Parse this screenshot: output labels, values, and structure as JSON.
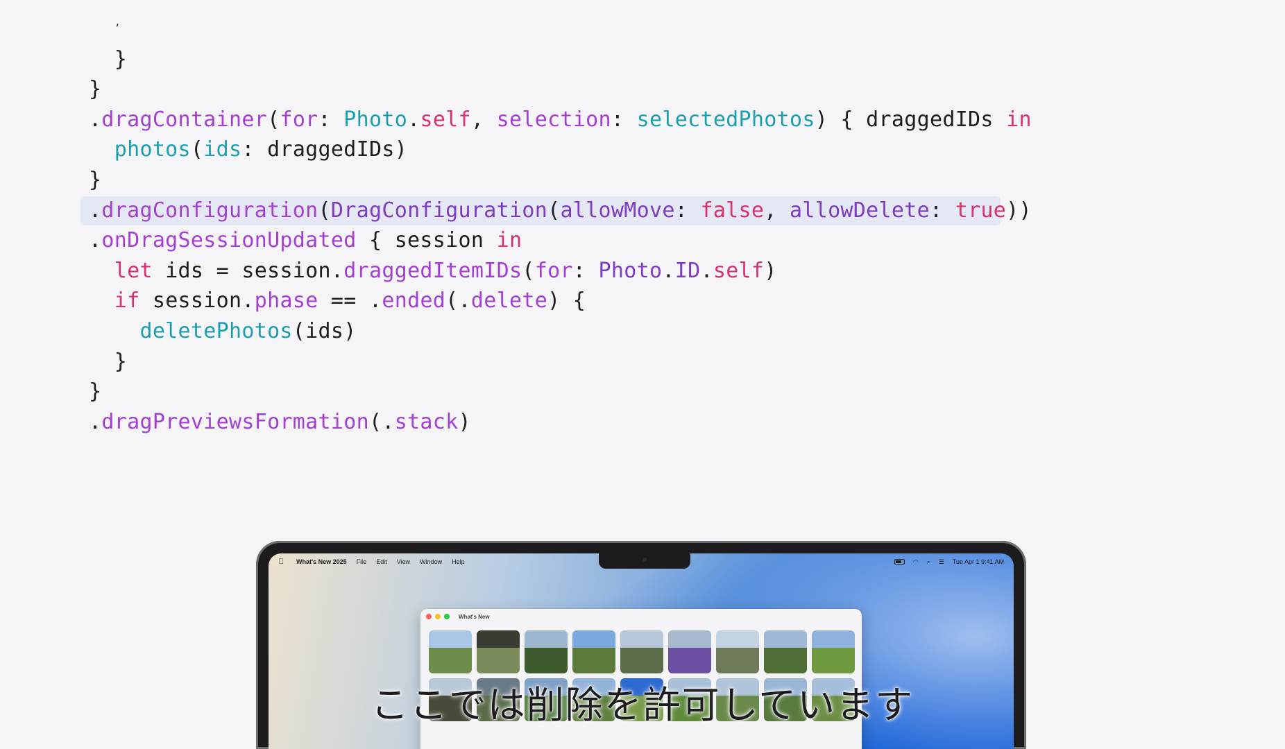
{
  "code": {
    "lines": [
      {
        "indent": 1,
        "tokens": [
          {
            "t": "ʼ",
            "c": "tiny"
          }
        ]
      },
      {
        "indent": 1,
        "tokens": [
          {
            "t": "}",
            "c": "plain"
          }
        ]
      },
      {
        "indent": 0,
        "tokens": [
          {
            "t": "}",
            "c": "plain"
          }
        ]
      },
      {
        "indent": 0,
        "tokens": [
          {
            "t": ".",
            "c": "plain"
          },
          {
            "t": "dragContainer",
            "c": "func"
          },
          {
            "t": "(",
            "c": "plain"
          },
          {
            "t": "for",
            "c": "func"
          },
          {
            "t": ": ",
            "c": "plain"
          },
          {
            "t": "Photo",
            "c": "call"
          },
          {
            "t": ".",
            "c": "plain"
          },
          {
            "t": "self",
            "c": "keyword"
          },
          {
            "t": ", ",
            "c": "plain"
          },
          {
            "t": "selection",
            "c": "func"
          },
          {
            "t": ": ",
            "c": "plain"
          },
          {
            "t": "selectedPhotos",
            "c": "call"
          },
          {
            "t": ") { draggedIDs ",
            "c": "plain"
          },
          {
            "t": "in",
            "c": "keyword"
          }
        ]
      },
      {
        "indent": 1,
        "tokens": [
          {
            "t": "photos",
            "c": "call"
          },
          {
            "t": "(",
            "c": "plain"
          },
          {
            "t": "ids",
            "c": "call"
          },
          {
            "t": ": draggedIDs)",
            "c": "plain"
          }
        ]
      },
      {
        "indent": 0,
        "tokens": [
          {
            "t": "}",
            "c": "plain"
          }
        ]
      },
      {
        "indent": 0,
        "highlight": true,
        "tokens": [
          {
            "t": ".",
            "c": "plain"
          },
          {
            "t": "dragConfiguration",
            "c": "func"
          },
          {
            "t": "(",
            "c": "plain"
          },
          {
            "t": "DragConfiguration",
            "c": "type"
          },
          {
            "t": "(",
            "c": "plain"
          },
          {
            "t": "allowMove",
            "c": "type"
          },
          {
            "t": ": ",
            "c": "plain"
          },
          {
            "t": "false",
            "c": "keyword"
          },
          {
            "t": ", ",
            "c": "plain"
          },
          {
            "t": "allowDelete",
            "c": "type"
          },
          {
            "t": ": ",
            "c": "plain"
          },
          {
            "t": "true",
            "c": "keyword"
          },
          {
            "t": "))",
            "c": "plain"
          }
        ]
      },
      {
        "indent": 0,
        "tokens": [
          {
            "t": ".",
            "c": "plain"
          },
          {
            "t": "onDragSessionUpdated",
            "c": "func"
          },
          {
            "t": " { session ",
            "c": "plain"
          },
          {
            "t": "in",
            "c": "keyword"
          }
        ]
      },
      {
        "indent": 1,
        "tokens": [
          {
            "t": "let",
            "c": "keyword"
          },
          {
            "t": " ids = session.",
            "c": "plain"
          },
          {
            "t": "draggedItemIDs",
            "c": "func"
          },
          {
            "t": "(",
            "c": "plain"
          },
          {
            "t": "for",
            "c": "func"
          },
          {
            "t": ": ",
            "c": "plain"
          },
          {
            "t": "Photo",
            "c": "type"
          },
          {
            "t": ".",
            "c": "plain"
          },
          {
            "t": "ID",
            "c": "type"
          },
          {
            "t": ".",
            "c": "plain"
          },
          {
            "t": "self",
            "c": "keyword"
          },
          {
            "t": ")",
            "c": "plain"
          }
        ]
      },
      {
        "indent": 1,
        "tokens": [
          {
            "t": "if",
            "c": "keyword"
          },
          {
            "t": " session.",
            "c": "plain"
          },
          {
            "t": "phase",
            "c": "func"
          },
          {
            "t": " == .",
            "c": "plain"
          },
          {
            "t": "ended",
            "c": "func"
          },
          {
            "t": "(.",
            "c": "plain"
          },
          {
            "t": "delete",
            "c": "func"
          },
          {
            "t": ") {",
            "c": "plain"
          }
        ]
      },
      {
        "indent": 2,
        "tokens": [
          {
            "t": "deletePhotos",
            "c": "call"
          },
          {
            "t": "(ids)",
            "c": "plain"
          }
        ]
      },
      {
        "indent": 1,
        "tokens": [
          {
            "t": "}",
            "c": "plain"
          }
        ]
      },
      {
        "indent": 0,
        "tokens": [
          {
            "t": "}",
            "c": "plain"
          }
        ]
      },
      {
        "indent": 0,
        "tokens": [
          {
            "t": ".",
            "c": "plain"
          },
          {
            "t": "dragPreviewsFormation",
            "c": "func"
          },
          {
            "t": "(.",
            "c": "plain"
          },
          {
            "t": "stack",
            "c": "func"
          },
          {
            "t": ")",
            "c": "plain"
          }
        ]
      }
    ]
  },
  "menubar": {
    "apple_glyph": "",
    "app_name": "What's New 2025",
    "menus": [
      "File",
      "Edit",
      "View",
      "Window",
      "Help"
    ],
    "wifi_glyph": "◠",
    "search_glyph": "⌕",
    "control_glyph": "☰",
    "datetime": "Tue Apr 1  9:41 AM"
  },
  "window": {
    "title": "What's New",
    "traffic_colors": [
      "#ff5f57",
      "#febc2e",
      "#28c840"
    ],
    "photos": [
      {
        "sky": "#a9c7e6",
        "land": "#6f8d4a"
      },
      {
        "sky": "#3b3a33",
        "land": "#7a8a5a"
      },
      {
        "sky": "#9db7cf",
        "land": "#3e5b2e"
      },
      {
        "sky": "#7aa8df",
        "land": "#5c7a3a"
      },
      {
        "sky": "#b7c7d9",
        "land": "#5a6c48"
      },
      {
        "sky": "#a7b8cf",
        "land": "#6a4fa2"
      },
      {
        "sky": "#c5d4e3",
        "land": "#6f7a5a"
      },
      {
        "sky": "#9fb9d8",
        "land": "#4f6f34"
      },
      {
        "sky": "#8fb2de",
        "land": "#6f9a3f"
      },
      {
        "sky": "#b9c8d6",
        "land": "#4a4a3a"
      },
      {
        "sky": "#6a7a86",
        "land": "#5c6c4a"
      },
      {
        "sky": "#7fa0c7",
        "land": "#4f7a3a"
      },
      {
        "sky": "#93b4d9",
        "land": "#5f7f3f"
      },
      {
        "sky": "#2d6ad0",
        "land": "#7a9a4a"
      },
      {
        "sky": "#a8c0d8",
        "land": "#5f8a3a"
      },
      {
        "sky": "#b0c4da",
        "land": "#6a8a4a"
      },
      {
        "sky": "#9ab6d6",
        "land": "#587a3c"
      },
      {
        "sky": "#a4bedb",
        "land": "#6c8f45"
      }
    ]
  },
  "subtitle": "ここでは削除を許可しています"
}
